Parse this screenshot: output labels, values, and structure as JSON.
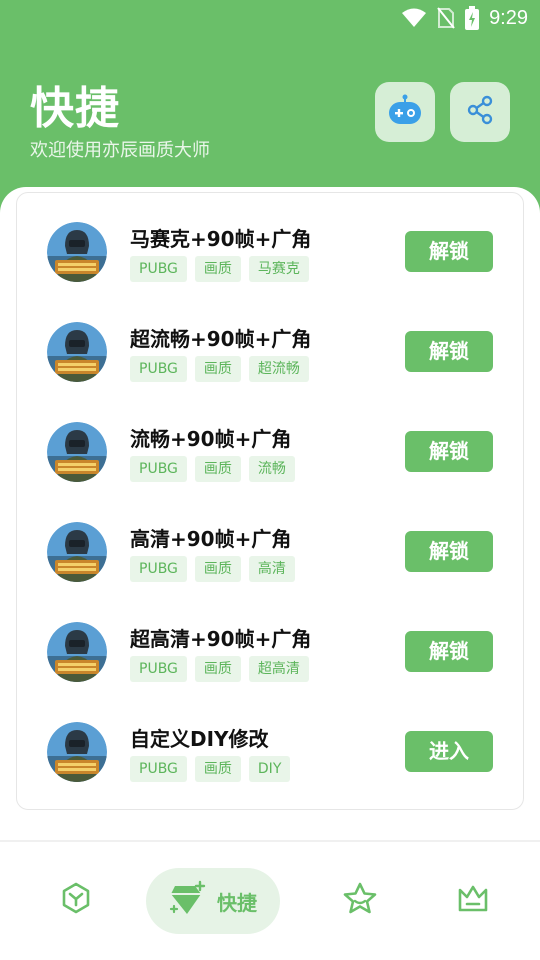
{
  "status_bar": {
    "time": "9:29"
  },
  "header": {
    "title": "快捷",
    "subtitle": "欢迎使用亦辰画质大师"
  },
  "items": [
    {
      "title": "马赛克+90帧+广角",
      "tags": [
        "PUBG",
        "画质",
        "马赛克"
      ],
      "button": "解锁"
    },
    {
      "title": "超流畅+90帧+广角",
      "tags": [
        "PUBG",
        "画质",
        "超流畅"
      ],
      "button": "解锁"
    },
    {
      "title": "流畅+90帧+广角",
      "tags": [
        "PUBG",
        "画质",
        "流畅"
      ],
      "button": "解锁"
    },
    {
      "title": "高清+90帧+广角",
      "tags": [
        "PUBG",
        "画质",
        "高清"
      ],
      "button": "解锁"
    },
    {
      "title": "超高清+90帧+广角",
      "tags": [
        "PUBG",
        "画质",
        "超高清"
      ],
      "button": "解锁"
    },
    {
      "title": "自定义DIY修改",
      "tags": [
        "PUBG",
        "画质",
        "DIY"
      ],
      "button": "进入"
    }
  ],
  "bottom_nav": {
    "active_label": "快捷",
    "items": [
      "home-hexagon-icon",
      "diamond-icon",
      "star-icon",
      "crown-icon"
    ]
  },
  "colors": {
    "primary": "#6abf69",
    "tag_bg": "#e9f5e9",
    "tag_text": "#5cb55b"
  }
}
